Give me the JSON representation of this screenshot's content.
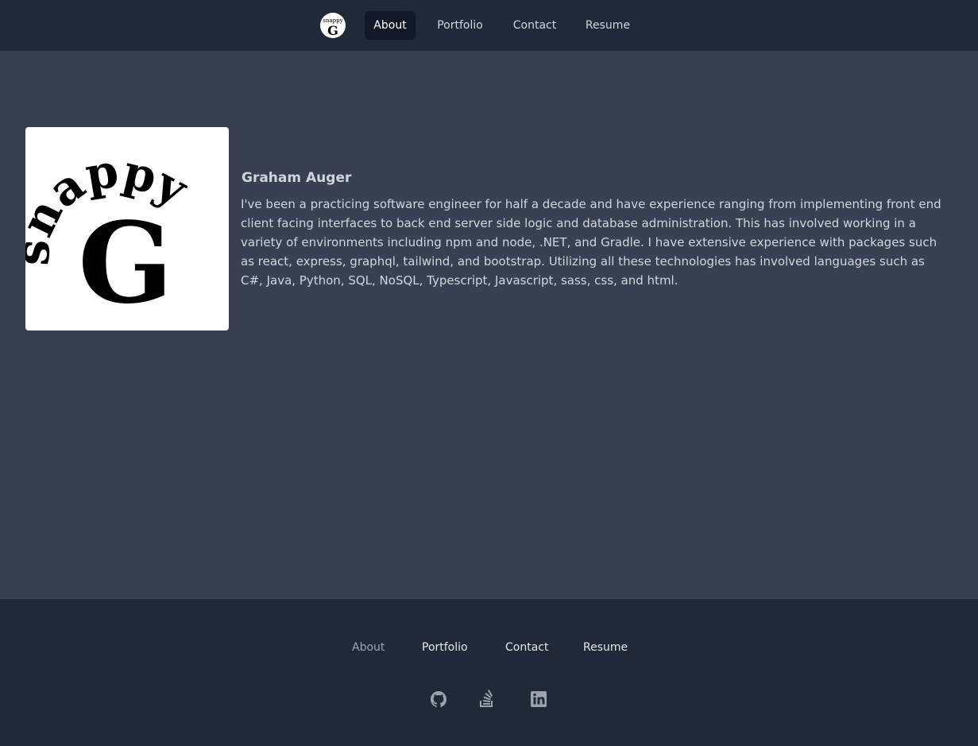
{
  "header": {
    "logo_alt": "snappy G",
    "nav": [
      {
        "label": "About",
        "active": true
      },
      {
        "label": "Portfolio",
        "active": false
      },
      {
        "label": "Contact",
        "active": false
      },
      {
        "label": "Resume",
        "active": false
      }
    ]
  },
  "profile": {
    "name": "Graham Auger",
    "bio": "I've been a practicing software engineer for half a decade and have experience ranging from implementing front end client facing interfaces to back end server side logic and database administration. This has involved working in a variety of environments including npm and node, .NET, and Gradle. I have extensive experience with packages such as react, express, graphql, tailwind, and bootstrap. Utilizing all these technologies has involved languages such as C#, Java, Python, SQL, NoSQL, Typescript, Javascript, sass, css, and html.",
    "logo_text": "snappy",
    "logo_letter": "G"
  },
  "footer": {
    "nav": [
      {
        "label": "About"
      },
      {
        "label": "Portfolio"
      },
      {
        "label": "Contact"
      },
      {
        "label": "Resume"
      }
    ],
    "social": [
      "github-icon",
      "stackoverflow-icon",
      "linkedin-icon"
    ]
  },
  "colors": {
    "page_bg": "#374151",
    "bar_bg": "#1f2937",
    "active_tab_bg": "#111827",
    "text": "#d1d5db"
  }
}
